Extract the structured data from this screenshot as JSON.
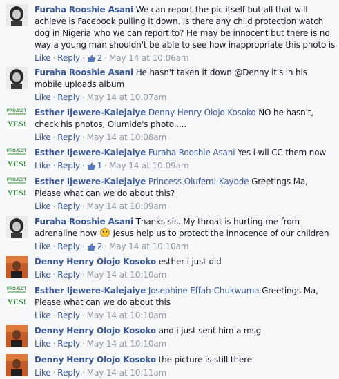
{
  "comments": [
    {
      "id": "c1",
      "author": "Furaha Rooshie Asani",
      "avatar_icon": "woman-portrait-avatar",
      "mention": "",
      "text": "We can report the pic itself but all that will achieve is Facebook pulling it down. Is there any child protection watch dog in Nigeria who we can report to? He may be innocent but there is no way a young man shouldn't be able to see how inappropriate this photo is",
      "like_label": "Like",
      "reply_label": "Reply",
      "like_count": "2",
      "timestamp": "May 14 at 10:06am"
    },
    {
      "id": "c2",
      "author": "Furaha Rooshie Asani",
      "avatar_icon": "woman-portrait-avatar",
      "mention": "",
      "text": "He hasn't taken it down @Denny it's in his mobile uploads album",
      "like_label": "Like",
      "reply_label": "Reply",
      "like_count": "",
      "timestamp": "May 14 at 10:07am"
    },
    {
      "id": "c3",
      "author": "Esther Ijewere-Kalejaiye",
      "avatar_icon": "project-yes-logo-avatar",
      "mention": "Denny Henry Olojo Kosoko",
      "text": "NO he hasn't, check his photos, Olumide's photo.....",
      "like_label": "Like",
      "reply_label": "Reply",
      "like_count": "",
      "timestamp": "May 14 at 10:08am"
    },
    {
      "id": "c4",
      "author": "Esther Ijewere-Kalejaiye",
      "avatar_icon": "project-yes-logo-avatar",
      "mention": "Furaha Rooshie Asani",
      "text": "Yes i wll CC them now",
      "like_label": "Like",
      "reply_label": "Reply",
      "like_count": "1",
      "timestamp": "May 14 at 10:09am"
    },
    {
      "id": "c5",
      "author": "Esther Ijewere-Kalejaiye",
      "avatar_icon": "project-yes-logo-avatar",
      "mention": "Princess Olufemi-Kayode",
      "text": "Greetings Ma, Please what can we do about this?",
      "like_label": "Like",
      "reply_label": "Reply",
      "like_count": "",
      "timestamp": "May 14 at 10:09am"
    },
    {
      "id": "c6",
      "author": "Furaha Rooshie Asani",
      "avatar_icon": "woman-portrait-avatar",
      "mention": "",
      "text": "Thanks sis. My throat is hurting me from adrenaline now",
      "text_after_emoji": "Jesus help us to protect the innocence of our children",
      "emoji_icon": "frown-emoji-icon",
      "like_label": "Like",
      "reply_label": "Reply",
      "like_count": "2",
      "timestamp": "May 14 at 10:10am"
    },
    {
      "id": "c7",
      "author": "Denny Henry Olojo Kosoko",
      "avatar_icon": "man-portrait-avatar",
      "mention": "",
      "text": "esther i just did",
      "like_label": "Like",
      "reply_label": "Reply",
      "like_count": "",
      "timestamp": "May 14 at 10:10am"
    },
    {
      "id": "c8",
      "author": "Esther Ijewere-Kalejaiye",
      "avatar_icon": "project-yes-logo-avatar",
      "mention": "Josephine Effah-Chukwuma",
      "text": "Greetings Ma, Please what can we do about this",
      "like_label": "Like",
      "reply_label": "Reply",
      "like_count": "",
      "timestamp": "May 14 at 10:10am"
    },
    {
      "id": "c9",
      "author": "Denny Henry Olojo Kosoko",
      "avatar_icon": "man-portrait-avatar",
      "mention": "",
      "text": "and i just sent him a msg",
      "like_label": "Like",
      "reply_label": "Reply",
      "like_count": "",
      "timestamp": "May 14 at 10:10am"
    },
    {
      "id": "c10",
      "author": "Denny Henry Olojo Kosoko",
      "avatar_icon": "man-portrait-avatar",
      "mention": "",
      "text": "the picture is still there",
      "like_label": "Like",
      "reply_label": "Reply",
      "like_count": "",
      "timestamp": "May 14 at 10:11am"
    }
  ],
  "avatar_logo_text": {
    "top": "PROJECT",
    "bottom": "YES!"
  },
  "colors": {
    "link": "#3b5998",
    "meta": "#9197a3",
    "text": "#141823",
    "background": "#f6f7f9"
  }
}
